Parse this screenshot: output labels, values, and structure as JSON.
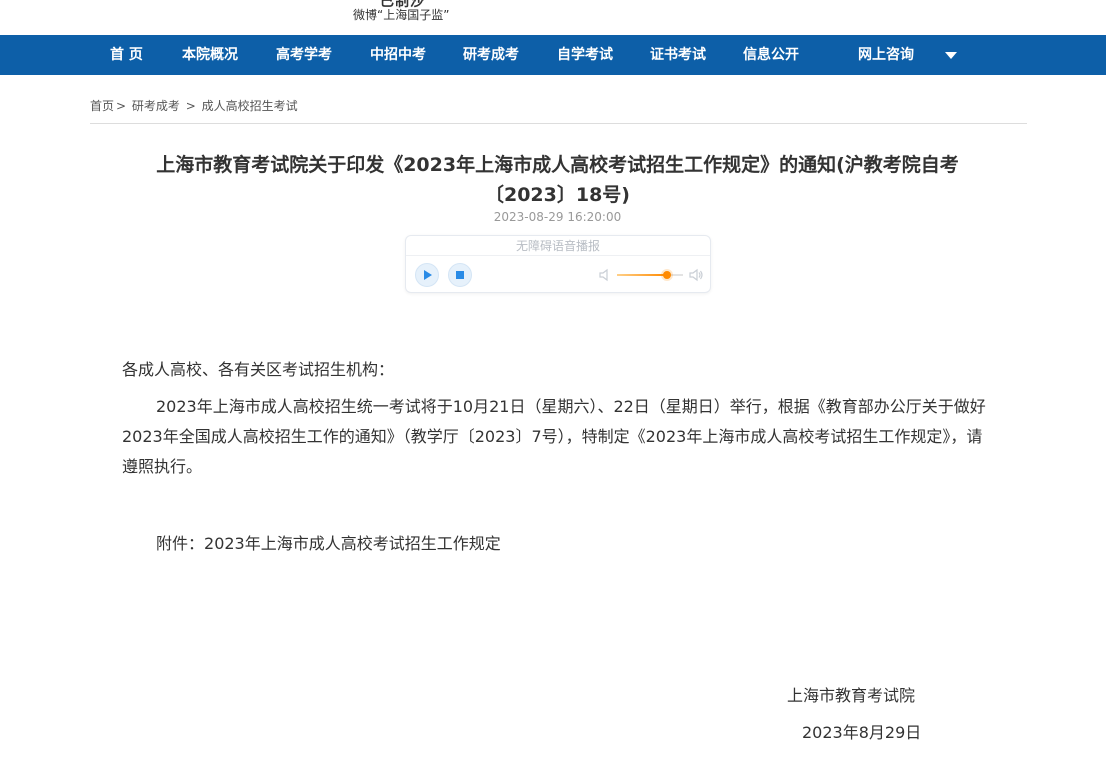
{
  "header": {
    "brand_fragment": "已制沙",
    "weibo_caption": "微博“上海国子监”"
  },
  "nav": {
    "items": [
      {
        "label": "首 页"
      },
      {
        "label": "本院概况"
      },
      {
        "label": "高考学考"
      },
      {
        "label": "中招中考"
      },
      {
        "label": "研考成考"
      },
      {
        "label": "自学考试"
      },
      {
        "label": "证书考试"
      },
      {
        "label": "信息公开"
      },
      {
        "label": "网上咨询"
      }
    ],
    "dropdown_icon": "caret-down-icon"
  },
  "breadcrumb": {
    "items": [
      "首页",
      "研考成考",
      "成人高校招生考试"
    ],
    "separator": ">"
  },
  "article": {
    "title": "上海市教育考试院关于印发《2023年上海市成人高校考试招生工作规定》的通知(沪教考院自考〔2023〕18号)",
    "date": "2023-08-29 16:20:00",
    "salutation": "各成人高校、各有关区考试招生机构：",
    "paragraph": "2023年上海市成人高校招生统一考试将于10月21日（星期六）、22日（星期日）举行，根据《教育部办公厅关于做好2023年全国成人高校招生工作的通知》（教学厅〔2023〕7号），特制定《2023年上海市成人高校考试招生工作规定》，请遵照执行。",
    "attachment_label": "附件：",
    "attachment_name": "2023年上海市成人高校考试招生工作规定",
    "signature": "上海市教育考试院",
    "sign_date": "2023年8月29日"
  },
  "audio_player": {
    "label": "无障碍语音播报",
    "volume_level": 0.75,
    "accent_color": "#2a8be6",
    "volume_color": "#ff8a00"
  },
  "colors": {
    "nav_bg": "#0d5fa8",
    "text": "#333333"
  }
}
